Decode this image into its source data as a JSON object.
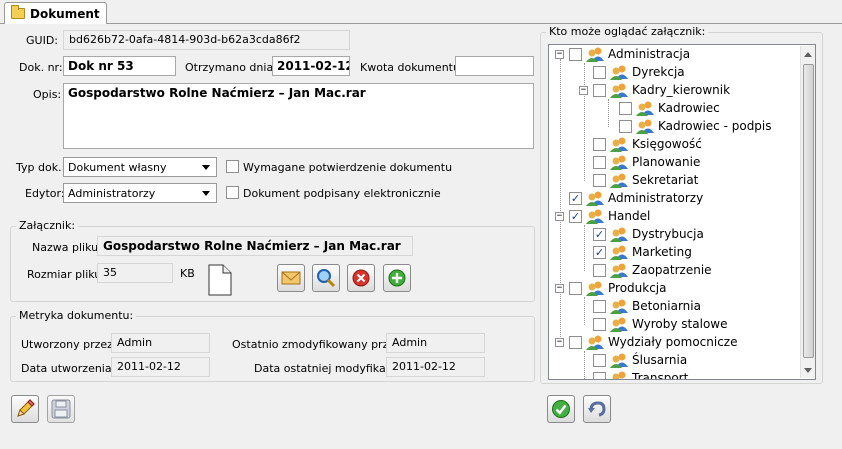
{
  "tab": {
    "label": "Dokument"
  },
  "form": {
    "guid_label": "GUID:",
    "guid_value": "bd626b72-0afa-4814-903d-b62a3cda86f2",
    "doknr_label": "Dok. nr:",
    "doknr_value": "Dok nr 53",
    "otrzymano_label": "Otrzymano dnia:",
    "otrzymano_value": "2011-02-12",
    "kwota_label": "Kwota dokumentu:",
    "kwota_value": "",
    "opis_label": "Opis:",
    "opis_value": "Gospodarstwo Rolne Naćmierz – Jan Mac.rar",
    "typ_label": "Typ dok.:",
    "typ_value": "Dokument własny",
    "wymagane_label": "Wymagane potwierdzenie dokumentu",
    "edytor_label": "Edytor:",
    "edytor_value": "Administratorzy",
    "podpisany_label": "Dokument podpisany elektronicznie"
  },
  "attachment": {
    "group_title": "Załącznik:",
    "nazwa_label": "Nazwa pliku:",
    "nazwa_value": "Gospodarstwo Rolne Naćmierz – Jan Mac.rar",
    "rozmiar_label": "Rozmiar pliku:",
    "rozmiar_value": "35",
    "unit": "KB"
  },
  "metrics": {
    "group_title": "Metryka dokumentu:",
    "utworzony_label": "Utworzony przez:",
    "utworzony_value": "Admin",
    "zmodyfikowany_label": "Ostatnio zmodyfikowany przez:",
    "zmodyfikowany_value": "Admin",
    "data_utw_label": "Data utworzenia:",
    "data_utw_value": "2011-02-12",
    "data_mod_label": "Data ostatniej modyfikacji:",
    "data_mod_value": "2011-02-12"
  },
  "tree": {
    "group_title": "Kto może oglądać załącznik:",
    "nodes": [
      {
        "label": "Administracja",
        "checked": false
      },
      {
        "label": "Dyrekcja",
        "checked": false
      },
      {
        "label": "Kadry_kierownik",
        "checked": false
      },
      {
        "label": "Kadrowiec",
        "checked": false
      },
      {
        "label": "Kadrowiec - podpis",
        "checked": false
      },
      {
        "label": "Księgowość",
        "checked": false
      },
      {
        "label": "Planowanie",
        "checked": false
      },
      {
        "label": "Sekretariat",
        "checked": false
      },
      {
        "label": "Administratorzy",
        "checked": true
      },
      {
        "label": "Handel",
        "checked": true
      },
      {
        "label": "Dystrybucja",
        "checked": true
      },
      {
        "label": "Marketing",
        "checked": true
      },
      {
        "label": "Zaopatrzenie",
        "checked": false
      },
      {
        "label": "Produkcja",
        "checked": false
      },
      {
        "label": "Betoniarnia",
        "checked": false
      },
      {
        "label": "Wyroby stalowe",
        "checked": false
      },
      {
        "label": "Wydziały pomocnicze",
        "checked": false
      },
      {
        "label": "Ślusarnia",
        "checked": false
      },
      {
        "label": "Transport",
        "checked": false
      }
    ]
  },
  "icons": {
    "edit": "pencil-icon",
    "save": "floppy-icon",
    "confirm": "check-icon",
    "undo": "undo-icon"
  }
}
